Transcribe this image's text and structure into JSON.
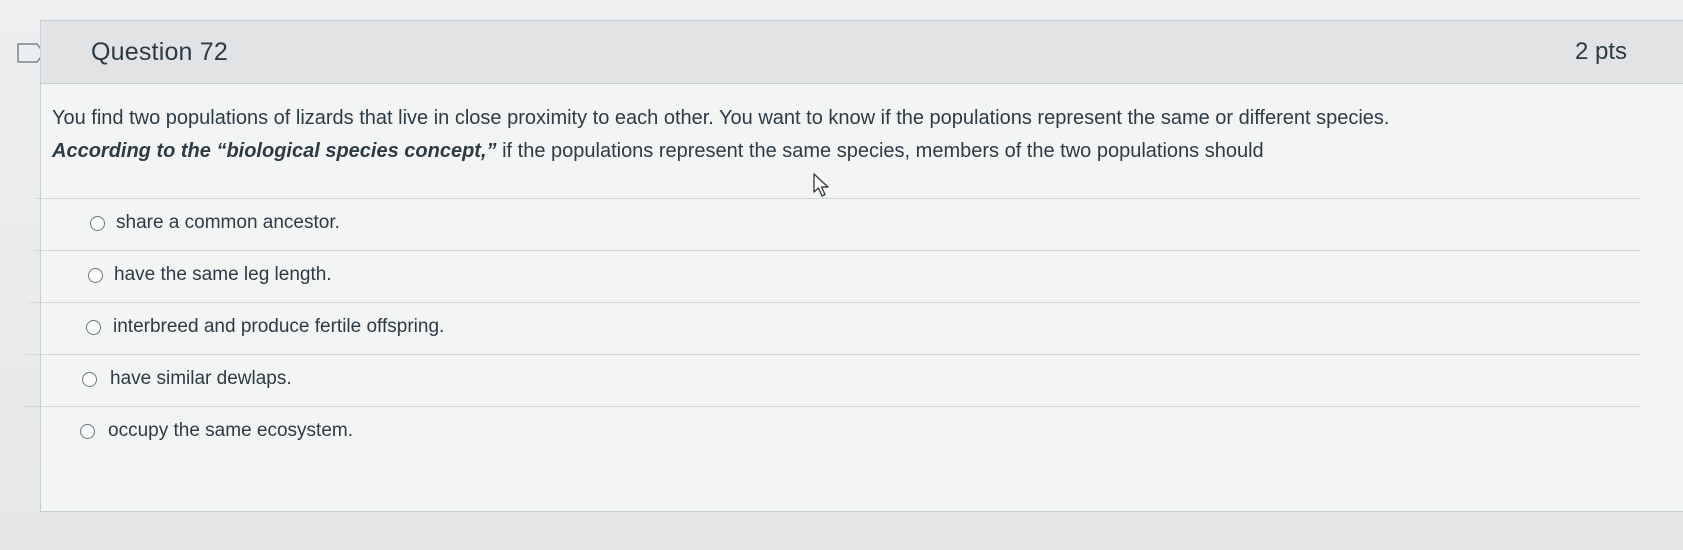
{
  "question": {
    "title": "Question 72",
    "points": "2 pts",
    "text_part1": "You find two populations of lizards that live in close proximity to each other. You want to know if the populations represent the same or different species.",
    "text_emphasis": "According to the “biological species concept,”",
    "text_part2": " if the populations represent the same species, members of the two populations should"
  },
  "answers": [
    {
      "label": "share a common ancestor."
    },
    {
      "label": "have the same leg length."
    },
    {
      "label": "interbreed and produce fertile offspring."
    },
    {
      "label": "have similar dewlaps."
    },
    {
      "label": "occupy the same ecosystem."
    }
  ],
  "icons": {
    "flag": "flag-icon",
    "cursor": "mouse-pointer-icon",
    "radio": "radio-unchecked-icon"
  },
  "colors": {
    "text": "#2d3b45",
    "header_bg": "#e2e3e4",
    "border": "#c7cdd1"
  }
}
